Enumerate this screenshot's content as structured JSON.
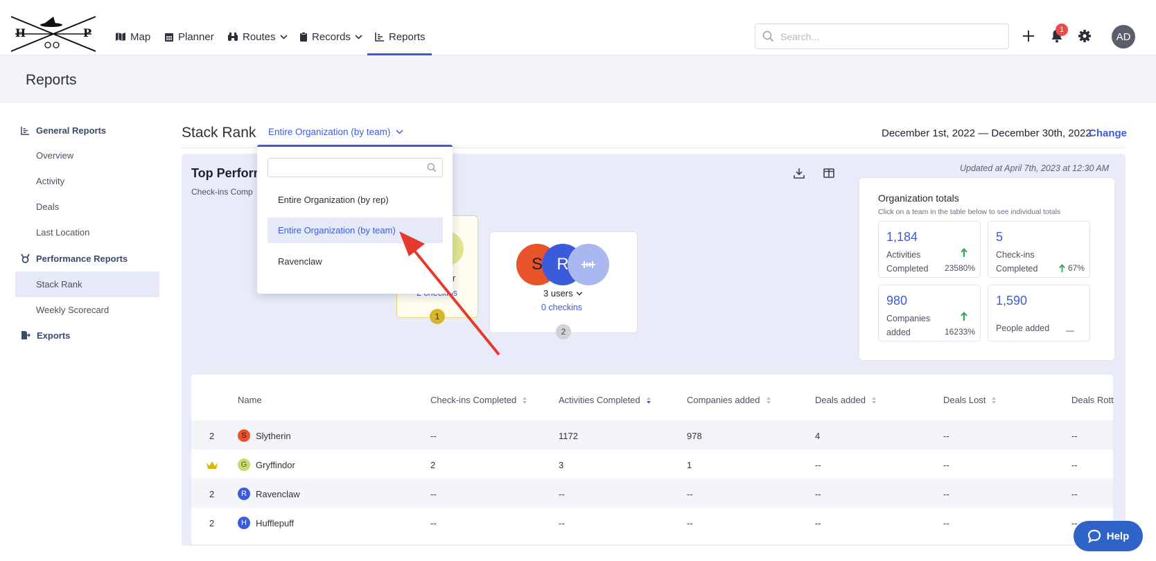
{
  "nav": {
    "items": [
      {
        "label": "Map",
        "icon": "map-icon"
      },
      {
        "label": "Planner",
        "icon": "calendar-icon"
      },
      {
        "label": "Routes",
        "icon": "binoculars-icon"
      },
      {
        "label": "Records",
        "icon": "clipboard-icon"
      },
      {
        "label": "Reports",
        "icon": "chart-icon"
      }
    ],
    "active": "Reports",
    "search_placeholder": "Search...",
    "notification_count": "1",
    "avatar_initials": "AD"
  },
  "logo": {
    "letters_left": "H",
    "letters_right": "P"
  },
  "page": {
    "title": "Reports"
  },
  "sidebar": {
    "general_heading": "General Reports",
    "general_items": [
      "Overview",
      "Activity",
      "Deals",
      "Last Location"
    ],
    "performance_heading": "Performance Reports",
    "performance_items": [
      "Stack Rank",
      "Weekly Scorecard"
    ],
    "exports_heading": "Exports",
    "active_item": "Stack Rank"
  },
  "stack_rank": {
    "title": "Stack Rank",
    "scope_value": "Entire Organization (by team)",
    "date_range": "December 1st, 2022 — December 30th, 2022",
    "change_label": "Change",
    "panel_title": "Top Perform",
    "panel_sub": "Check-ins Comp",
    "updated": "Updated at April 7th, 2023 at 12:30 AM"
  },
  "podium": {
    "first": {
      "rank": "1",
      "label_fragment": "r",
      "checkins_fragment": "2 checkins"
    },
    "second": {
      "rank": "2",
      "users": "3 users",
      "checkins": "0 checkins",
      "avatars": [
        "S",
        "R",
        "H"
      ]
    }
  },
  "totals": {
    "title": "Organization totals",
    "subtitle": "Click on a team in the table below to see individual totals",
    "boxes": [
      {
        "value": "1,184",
        "label1": "Activities",
        "label2": "Completed",
        "change": "23580%",
        "trend": "up"
      },
      {
        "value": "5",
        "label1": "Check-ins",
        "label2": "Completed",
        "change": "67%",
        "trend": "up"
      },
      {
        "value": "980",
        "label1": "Companies",
        "label2": "added",
        "change": "16233%",
        "trend": "up"
      },
      {
        "value": "1,590",
        "label1": "People added",
        "label2": "",
        "change": "—",
        "trend": "none"
      }
    ]
  },
  "table": {
    "columns": [
      "Name",
      "Check-ins Completed",
      "Activities Completed",
      "Companies added",
      "Deals added",
      "Deals Lost",
      "Deals Rott"
    ],
    "rows": [
      {
        "rank": "2",
        "initial": "S",
        "name": "Slytherin",
        "color": "#e8532a",
        "checkins": "--",
        "activities": "1172",
        "companies": "978",
        "deals_added": "4",
        "deals_lost": "--",
        "deals_rott": "--"
      },
      {
        "rank": "crown",
        "initial": "G",
        "name": "Gryffindor",
        "color": "#cfd96a",
        "checkins": "2",
        "activities": "3",
        "companies": "1",
        "deals_added": "--",
        "deals_lost": "--",
        "deals_rott": "--"
      },
      {
        "rank": "2",
        "initial": "R",
        "name": "Ravenclaw",
        "color": "#3b5bdb",
        "checkins": "--",
        "activities": "--",
        "companies": "--",
        "deals_added": "--",
        "deals_lost": "--",
        "deals_rott": "--"
      },
      {
        "rank": "2",
        "initial": "H",
        "name": "Hufflepuff",
        "color": "#3b5bdb",
        "checkins": "--",
        "activities": "--",
        "companies": "--",
        "deals_added": "--",
        "deals_lost": "--",
        "deals_rott": "--"
      }
    ]
  },
  "dropdown": {
    "search_value": "",
    "options": [
      "Entire Organization (by rep)",
      "Entire Organization (by team)",
      "Ravenclaw"
    ],
    "selected": "Entire Organization (by team)"
  },
  "help": {
    "label": "Help"
  },
  "colors": {
    "accent": "#3d5bd9",
    "annotation_arrow": "#e53a2b",
    "gold": "#d9b600"
  }
}
